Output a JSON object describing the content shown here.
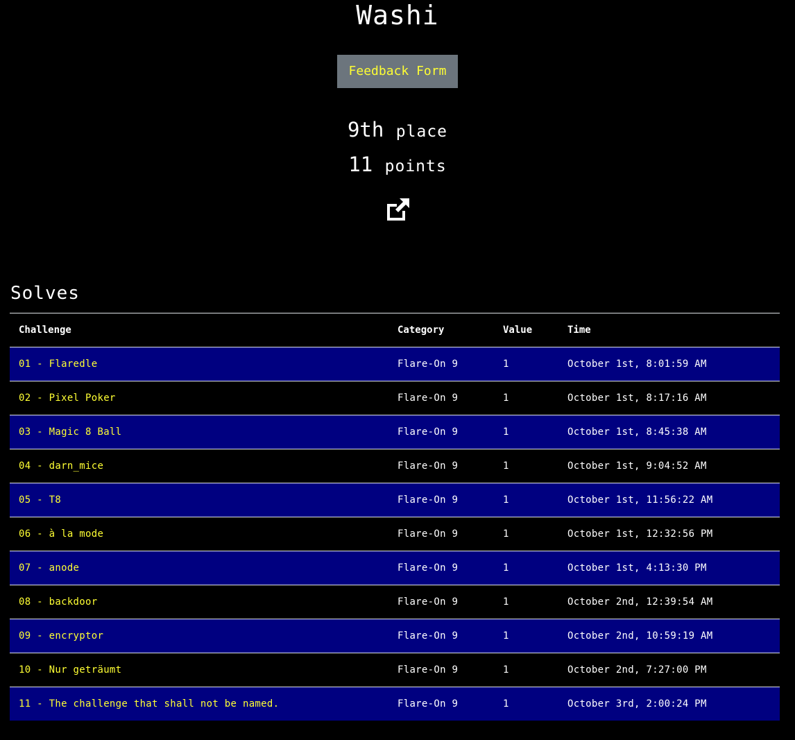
{
  "team": {
    "name": "Washi",
    "feedback_label": "Feedback Form",
    "place_value": "9th",
    "place_word": "place",
    "points_value": "11",
    "points_word": "points",
    "link_icon": "external-link-icon"
  },
  "solves": {
    "title": "Solves",
    "columns": [
      "Challenge",
      "Category",
      "Value",
      "Time"
    ],
    "rows": [
      {
        "challenge": "01 - Flaredle",
        "category": "Flare-On 9",
        "value": "1",
        "time": "October 1st, 8:01:59 AM"
      },
      {
        "challenge": "02 - Pixel Poker",
        "category": "Flare-On 9",
        "value": "1",
        "time": "October 1st, 8:17:16 AM"
      },
      {
        "challenge": "03 - Magic 8 Ball",
        "category": "Flare-On 9",
        "value": "1",
        "time": "October 1st, 8:45:38 AM"
      },
      {
        "challenge": "04 - darn_mice",
        "category": "Flare-On 9",
        "value": "1",
        "time": "October 1st, 9:04:52 AM"
      },
      {
        "challenge": "05 - T8",
        "category": "Flare-On 9",
        "value": "1",
        "time": "October 1st, 11:56:22 AM"
      },
      {
        "challenge": "06 - à la mode",
        "category": "Flare-On 9",
        "value": "1",
        "time": "October 1st, 12:32:56 PM"
      },
      {
        "challenge": "07 - anode",
        "category": "Flare-On 9",
        "value": "1",
        "time": "October 1st, 4:13:30 PM"
      },
      {
        "challenge": "08 - backdoor",
        "category": "Flare-On 9",
        "value": "1",
        "time": "October 2nd, 12:39:54 AM"
      },
      {
        "challenge": "09 - encryptor",
        "category": "Flare-On 9",
        "value": "1",
        "time": "October 2nd, 10:59:19 AM"
      },
      {
        "challenge": "10 - Nur geträumt",
        "category": "Flare-On 9",
        "value": "1",
        "time": "October 2nd, 7:27:00 PM"
      },
      {
        "challenge": "11 - The challenge that shall not be named.",
        "category": "Flare-On 9",
        "value": "1",
        "time": "October 3rd, 2:00:24 PM"
      }
    ]
  },
  "colors": {
    "background": "#000000",
    "row_highlight": "#000080",
    "link_text": "#ffff33",
    "button_bg": "#6c757d"
  }
}
